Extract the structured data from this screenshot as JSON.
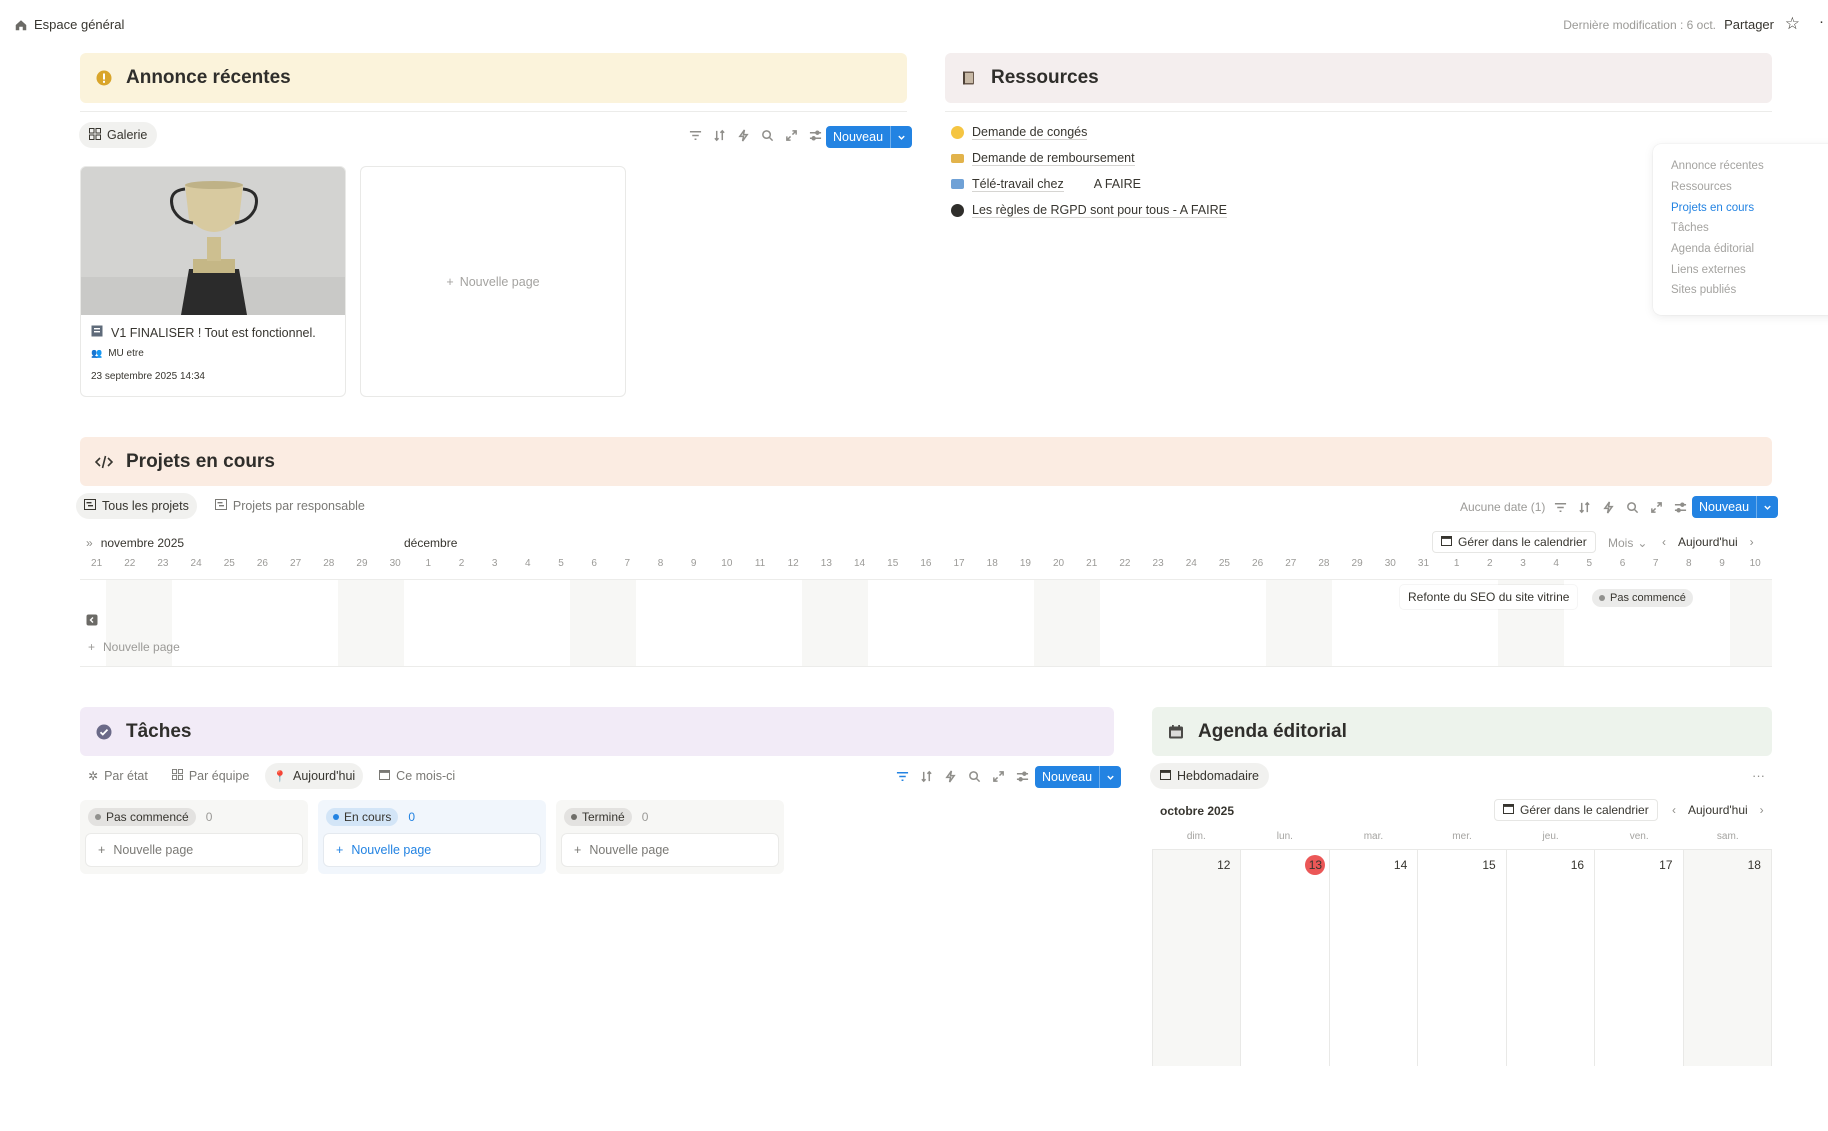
{
  "topbar": {
    "breadcrumb": "Espace général",
    "last_modified": "Dernière modification : 6 oct.",
    "share": "Partager"
  },
  "annonces": {
    "title": "Annonce récentes",
    "view_chip": "Galerie",
    "new_button": "Nouveau",
    "cards": [
      {
        "title": "V1 FINALISER ! Tout est fonctionnel.",
        "author": "MU etre",
        "date": "23 septembre 2025 14:34"
      }
    ],
    "new_page": "Nouvelle page"
  },
  "ressources": {
    "title": "Ressources",
    "items": [
      {
        "label": "Demande de congés",
        "icon": "sunglasses-icon"
      },
      {
        "label": "Demande de remboursement",
        "icon": "credit-card-icon"
      },
      {
        "label": "Télé-travail chez",
        "suffix": "A FAIRE",
        "icon": "laptop-icon"
      },
      {
        "label": "Les règles de RGPD sont pour tous - A FAIRE",
        "icon": "badge-icon"
      }
    ]
  },
  "toc": {
    "items": [
      "Annonce récentes",
      "Ressources",
      "Projets en cours",
      "Tâches",
      "Agenda éditorial",
      "Liens externes",
      "Sites publiés"
    ],
    "active_index": 2
  },
  "projets": {
    "title": "Projets en cours",
    "tabs": [
      "Tous les projets",
      "Projets par responsable"
    ],
    "no_date": "Aucune date (1)",
    "new_button": "Nouveau",
    "month_left": "novembre 2025",
    "month_right": "décembre",
    "manage_calendar": "Gérer dans le calendrier",
    "scale": "Mois",
    "today": "Aujourd'hui",
    "days": [
      "21",
      "22",
      "23",
      "24",
      "25",
      "26",
      "27",
      "28",
      "29",
      "30",
      "1",
      "2",
      "3",
      "4",
      "5",
      "6",
      "7",
      "8",
      "9",
      "10",
      "11",
      "12",
      "13",
      "14",
      "15",
      "16",
      "17",
      "18",
      "19",
      "20",
      "21",
      "22",
      "23",
      "24",
      "25",
      "26",
      "27",
      "28",
      "29",
      "30",
      "31",
      "1",
      "2",
      "3",
      "4",
      "5",
      "6",
      "7",
      "8",
      "9",
      "10"
    ],
    "task_label": "Refonte du SEO du site vitrine",
    "task_status": "Pas commencé",
    "new_page": "Nouvelle page"
  },
  "taches": {
    "title": "Tâches",
    "tabs": [
      "Par état",
      "Par équipe",
      "Aujourd'hui",
      "Ce mois-ci"
    ],
    "active_tab": 2,
    "new_button": "Nouveau",
    "columns": [
      {
        "status": "Pas commencé",
        "count": "0",
        "new_page": "Nouvelle page",
        "color": "#91918e"
      },
      {
        "status": "En cours",
        "count": "0",
        "new_page": "Nouvelle page",
        "color": "#2383e2"
      },
      {
        "status": "Terminé",
        "count": "0",
        "new_page": "Nouvelle page",
        "color": "#6f6e69"
      }
    ]
  },
  "agenda": {
    "title": "Agenda éditorial",
    "view_chip": "Hebdomadaire",
    "month": "octobre 2025",
    "manage_calendar": "Gérer dans le calendrier",
    "today": "Aujourd'hui",
    "weekdays": [
      "dim.",
      "lun.",
      "mar.",
      "mer.",
      "jeu.",
      "ven.",
      "sam."
    ],
    "dates": [
      "12",
      "13",
      "14",
      "15",
      "16",
      "17",
      "18"
    ],
    "today_index": 1
  },
  "colors": {
    "accent": "#2383e2",
    "annonces_bg": "#fbf3db",
    "ressources_bg": "#f4eeee",
    "projets_bg": "#fbece2",
    "taches_bg": "#f2ebf7",
    "agenda_bg": "#edf3ec",
    "today_red": "#eb5757"
  }
}
